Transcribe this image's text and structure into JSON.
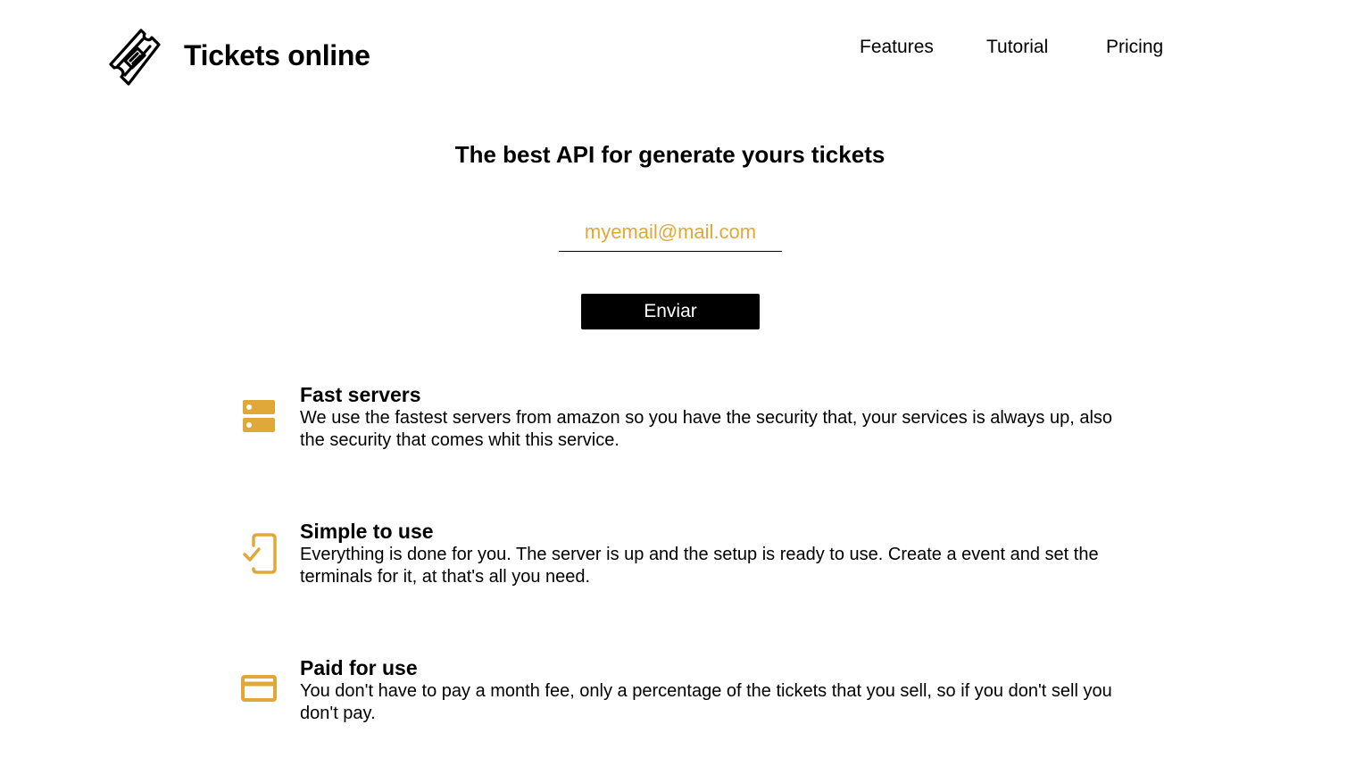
{
  "header": {
    "brand": "Tickets online",
    "logo_icon": "ticket-icon",
    "nav": [
      {
        "label": "Features"
      },
      {
        "label": "Tutorial"
      },
      {
        "label": "Pricing"
      }
    ]
  },
  "hero": {
    "headline": "The best API for generate yours tickets",
    "email_placeholder": "myemail@mail.com",
    "submit_label": "Enviar"
  },
  "features": [
    {
      "icon": "server-icon",
      "title": "Fast servers",
      "description": "We use the fastest servers from amazon so you have the security that, your services is always up, also the security that comes whit this service."
    },
    {
      "icon": "mobile-check-icon",
      "title": "Simple to use",
      "description": "Everything is done for you. The server is up and the setup is ready to use. Create a event and set the terminals for it, at that's all you need."
    },
    {
      "icon": "credit-card-icon",
      "title": "Paid for use",
      "description": "You don't have to pay a month fee, only a percentage of the tickets that you sell, so if you don't sell you don't pay."
    }
  ],
  "colors": {
    "accent": "#e0a838",
    "button_bg": "#000000",
    "button_text": "#ffffff",
    "text": "#000000",
    "background": "#ffffff"
  }
}
